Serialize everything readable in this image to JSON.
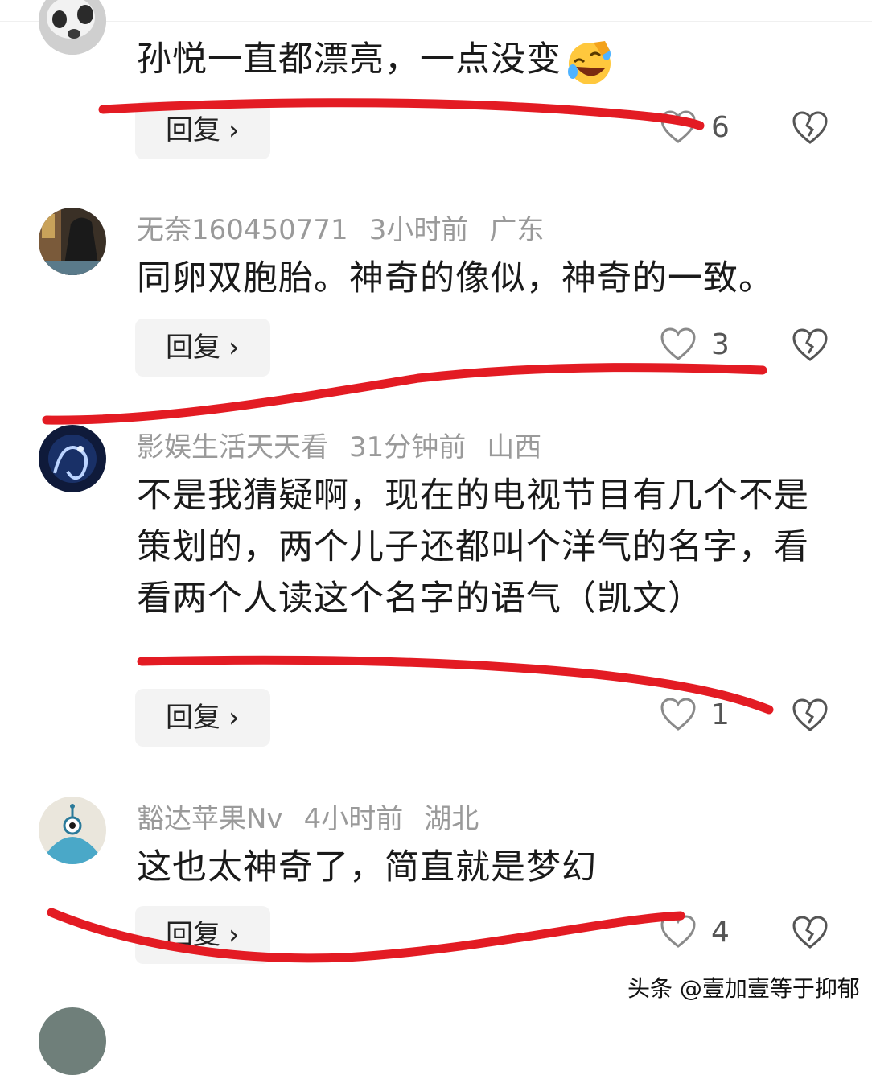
{
  "comments": [
    {
      "author": "",
      "time": "",
      "location": "",
      "text": "孙悦一直都漂亮，一点没变",
      "emoji": "rolling-on-floor-laughing",
      "reply_label": "回复",
      "likes": "6"
    },
    {
      "author": "无奈160450771",
      "time": "3小时前",
      "location": "广东",
      "text": "同卵双胞胎。神奇的像似，神奇的一致。",
      "reply_label": "回复",
      "likes": "3"
    },
    {
      "author": "影娱生活天天看",
      "time": "31分钟前",
      "location": "山西",
      "text": "不是我猜疑啊，现在的电视节目有几个不是策划的，两个儿子还都叫个洋气的名字，看看两个人读这个名字的语气（凯文）",
      "reply_label": "回复",
      "likes": "1"
    },
    {
      "author": "豁达苹果Nv",
      "time": "4小时前",
      "location": "湖北",
      "text": "这也太神奇了，简直就是梦幻",
      "reply_label": "回复",
      "likes": "4"
    }
  ],
  "watermark": "头条 @壹加壹等于抑郁",
  "colors": {
    "annotation_red": "#e31b23",
    "meta_gray": "#9a9a9a",
    "reply_bg": "#f3f3f3"
  }
}
